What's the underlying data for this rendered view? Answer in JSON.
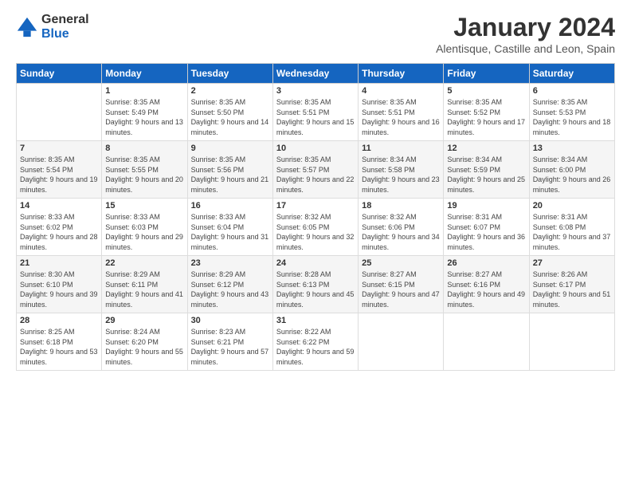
{
  "logo": {
    "general": "General",
    "blue": "Blue"
  },
  "title": "January 2024",
  "subtitle": "Alentisque, Castille and Leon, Spain",
  "headers": [
    "Sunday",
    "Monday",
    "Tuesday",
    "Wednesday",
    "Thursday",
    "Friday",
    "Saturday"
  ],
  "weeks": [
    [
      {
        "day": "",
        "sunrise": "",
        "sunset": "",
        "daylight": ""
      },
      {
        "day": "1",
        "sunrise": "Sunrise: 8:35 AM",
        "sunset": "Sunset: 5:49 PM",
        "daylight": "Daylight: 9 hours and 13 minutes."
      },
      {
        "day": "2",
        "sunrise": "Sunrise: 8:35 AM",
        "sunset": "Sunset: 5:50 PM",
        "daylight": "Daylight: 9 hours and 14 minutes."
      },
      {
        "day": "3",
        "sunrise": "Sunrise: 8:35 AM",
        "sunset": "Sunset: 5:51 PM",
        "daylight": "Daylight: 9 hours and 15 minutes."
      },
      {
        "day": "4",
        "sunrise": "Sunrise: 8:35 AM",
        "sunset": "Sunset: 5:51 PM",
        "daylight": "Daylight: 9 hours and 16 minutes."
      },
      {
        "day": "5",
        "sunrise": "Sunrise: 8:35 AM",
        "sunset": "Sunset: 5:52 PM",
        "daylight": "Daylight: 9 hours and 17 minutes."
      },
      {
        "day": "6",
        "sunrise": "Sunrise: 8:35 AM",
        "sunset": "Sunset: 5:53 PM",
        "daylight": "Daylight: 9 hours and 18 minutes."
      }
    ],
    [
      {
        "day": "7",
        "sunrise": "Sunrise: 8:35 AM",
        "sunset": "Sunset: 5:54 PM",
        "daylight": "Daylight: 9 hours and 19 minutes."
      },
      {
        "day": "8",
        "sunrise": "Sunrise: 8:35 AM",
        "sunset": "Sunset: 5:55 PM",
        "daylight": "Daylight: 9 hours and 20 minutes."
      },
      {
        "day": "9",
        "sunrise": "Sunrise: 8:35 AM",
        "sunset": "Sunset: 5:56 PM",
        "daylight": "Daylight: 9 hours and 21 minutes."
      },
      {
        "day": "10",
        "sunrise": "Sunrise: 8:35 AM",
        "sunset": "Sunset: 5:57 PM",
        "daylight": "Daylight: 9 hours and 22 minutes."
      },
      {
        "day": "11",
        "sunrise": "Sunrise: 8:34 AM",
        "sunset": "Sunset: 5:58 PM",
        "daylight": "Daylight: 9 hours and 23 minutes."
      },
      {
        "day": "12",
        "sunrise": "Sunrise: 8:34 AM",
        "sunset": "Sunset: 5:59 PM",
        "daylight": "Daylight: 9 hours and 25 minutes."
      },
      {
        "day": "13",
        "sunrise": "Sunrise: 8:34 AM",
        "sunset": "Sunset: 6:00 PM",
        "daylight": "Daylight: 9 hours and 26 minutes."
      }
    ],
    [
      {
        "day": "14",
        "sunrise": "Sunrise: 8:33 AM",
        "sunset": "Sunset: 6:02 PM",
        "daylight": "Daylight: 9 hours and 28 minutes."
      },
      {
        "day": "15",
        "sunrise": "Sunrise: 8:33 AM",
        "sunset": "Sunset: 6:03 PM",
        "daylight": "Daylight: 9 hours and 29 minutes."
      },
      {
        "day": "16",
        "sunrise": "Sunrise: 8:33 AM",
        "sunset": "Sunset: 6:04 PM",
        "daylight": "Daylight: 9 hours and 31 minutes."
      },
      {
        "day": "17",
        "sunrise": "Sunrise: 8:32 AM",
        "sunset": "Sunset: 6:05 PM",
        "daylight": "Daylight: 9 hours and 32 minutes."
      },
      {
        "day": "18",
        "sunrise": "Sunrise: 8:32 AM",
        "sunset": "Sunset: 6:06 PM",
        "daylight": "Daylight: 9 hours and 34 minutes."
      },
      {
        "day": "19",
        "sunrise": "Sunrise: 8:31 AM",
        "sunset": "Sunset: 6:07 PM",
        "daylight": "Daylight: 9 hours and 36 minutes."
      },
      {
        "day": "20",
        "sunrise": "Sunrise: 8:31 AM",
        "sunset": "Sunset: 6:08 PM",
        "daylight": "Daylight: 9 hours and 37 minutes."
      }
    ],
    [
      {
        "day": "21",
        "sunrise": "Sunrise: 8:30 AM",
        "sunset": "Sunset: 6:10 PM",
        "daylight": "Daylight: 9 hours and 39 minutes."
      },
      {
        "day": "22",
        "sunrise": "Sunrise: 8:29 AM",
        "sunset": "Sunset: 6:11 PM",
        "daylight": "Daylight: 9 hours and 41 minutes."
      },
      {
        "day": "23",
        "sunrise": "Sunrise: 8:29 AM",
        "sunset": "Sunset: 6:12 PM",
        "daylight": "Daylight: 9 hours and 43 minutes."
      },
      {
        "day": "24",
        "sunrise": "Sunrise: 8:28 AM",
        "sunset": "Sunset: 6:13 PM",
        "daylight": "Daylight: 9 hours and 45 minutes."
      },
      {
        "day": "25",
        "sunrise": "Sunrise: 8:27 AM",
        "sunset": "Sunset: 6:15 PM",
        "daylight": "Daylight: 9 hours and 47 minutes."
      },
      {
        "day": "26",
        "sunrise": "Sunrise: 8:27 AM",
        "sunset": "Sunset: 6:16 PM",
        "daylight": "Daylight: 9 hours and 49 minutes."
      },
      {
        "day": "27",
        "sunrise": "Sunrise: 8:26 AM",
        "sunset": "Sunset: 6:17 PM",
        "daylight": "Daylight: 9 hours and 51 minutes."
      }
    ],
    [
      {
        "day": "28",
        "sunrise": "Sunrise: 8:25 AM",
        "sunset": "Sunset: 6:18 PM",
        "daylight": "Daylight: 9 hours and 53 minutes."
      },
      {
        "day": "29",
        "sunrise": "Sunrise: 8:24 AM",
        "sunset": "Sunset: 6:20 PM",
        "daylight": "Daylight: 9 hours and 55 minutes."
      },
      {
        "day": "30",
        "sunrise": "Sunrise: 8:23 AM",
        "sunset": "Sunset: 6:21 PM",
        "daylight": "Daylight: 9 hours and 57 minutes."
      },
      {
        "day": "31",
        "sunrise": "Sunrise: 8:22 AM",
        "sunset": "Sunset: 6:22 PM",
        "daylight": "Daylight: 9 hours and 59 minutes."
      },
      {
        "day": "",
        "sunrise": "",
        "sunset": "",
        "daylight": ""
      },
      {
        "day": "",
        "sunrise": "",
        "sunset": "",
        "daylight": ""
      },
      {
        "day": "",
        "sunrise": "",
        "sunset": "",
        "daylight": ""
      }
    ]
  ]
}
